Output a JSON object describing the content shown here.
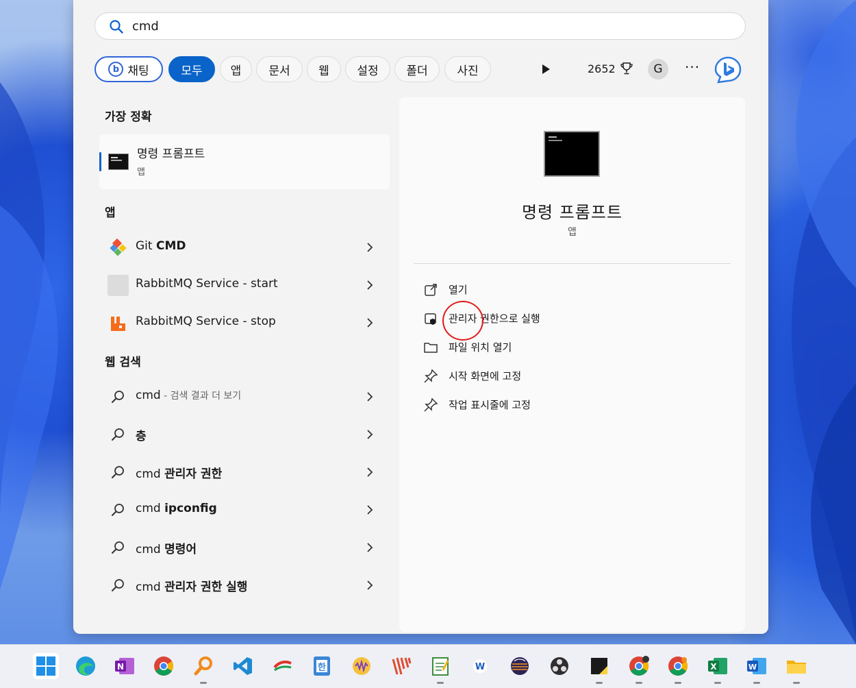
{
  "search": {
    "value": "cmd"
  },
  "filters": {
    "chat": "채팅",
    "items": [
      "모두",
      "앱",
      "문서",
      "웹",
      "설정",
      "폴더",
      "사진"
    ],
    "points": "2652",
    "avatar": "G",
    "more": "···"
  },
  "best_match": {
    "heading": "가장 정확",
    "title": "명령 프롬프트",
    "type": "앱"
  },
  "apps": {
    "heading": "앱",
    "items": [
      {
        "prefix": "Git ",
        "bold": "CMD"
      },
      {
        "label": "RabbitMQ Service - start"
      },
      {
        "label": "RabbitMQ Service - stop"
      }
    ]
  },
  "web": {
    "heading": "웹 검색",
    "items": [
      {
        "prefix": "cmd",
        "sub": " - 검색 결과 더 보기"
      },
      {
        "prefix": "",
        "bold": "층"
      },
      {
        "prefix": "cmd ",
        "bold": "관리자 권한"
      },
      {
        "prefix": "cmd ",
        "bold": "ipconfig"
      },
      {
        "prefix": "cmd ",
        "bold": "명령어"
      },
      {
        "prefix": "cmd ",
        "bold": "관리자 권한 실행"
      }
    ]
  },
  "detail": {
    "title": "명령 프롬프트",
    "type": "앱",
    "actions": [
      "열기",
      "관리자 권한으로 실행",
      "파일 위치 열기",
      "시작 화면에 고정",
      "작업 표시줄에 고정"
    ]
  },
  "colors": {
    "accent": "#0a63c9",
    "highlight_circle": "#e01a1a"
  },
  "taskbar": {
    "icons": [
      "windows-start-icon",
      "edge-icon",
      "onenote-icon",
      "chrome-icon",
      "search-magnifier-app-icon",
      "vscode-icon",
      "app-icon",
      "hwp-icon",
      "audio-app-icon",
      "app-stripes-icon",
      "notepad-icon",
      "app-icon",
      "eclipse-icon",
      "obs-icon",
      "sticky-notes-icon",
      "chrome-icon",
      "chrome-icon",
      "excel-icon",
      "word-icon",
      "file-explorer-icon"
    ]
  }
}
